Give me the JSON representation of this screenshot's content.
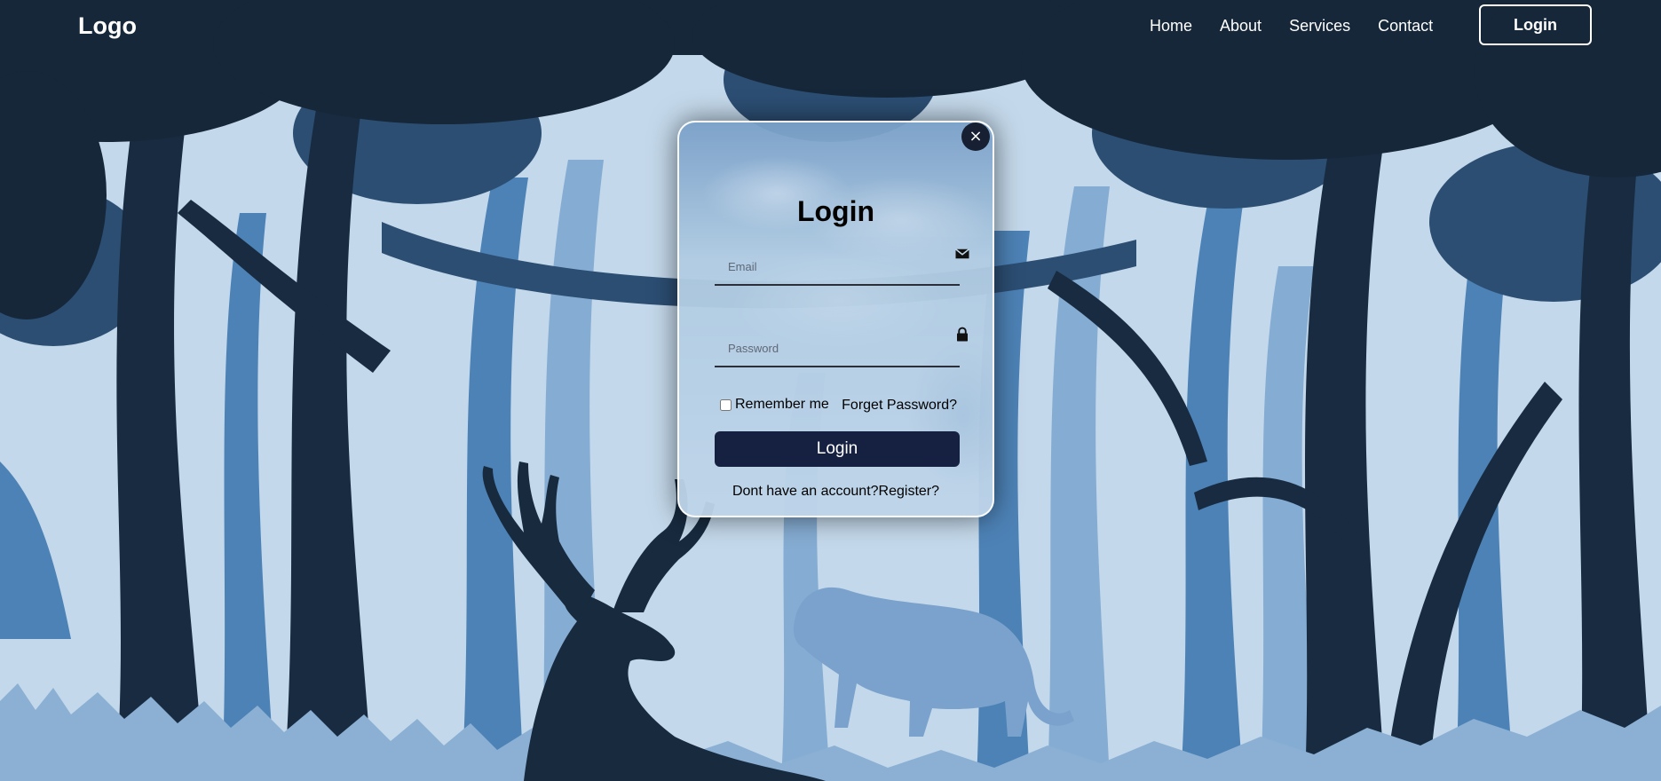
{
  "header": {
    "logo": "Logo",
    "nav": [
      "Home",
      "About",
      "Services",
      "Contact"
    ],
    "login_button": "Login"
  },
  "modal": {
    "close_icon": "×",
    "title": "Login",
    "email": {
      "placeholder": "Email",
      "icon": "envelope-icon"
    },
    "password": {
      "placeholder": "Password",
      "icon": "lock-icon"
    },
    "remember_label": "Remember me",
    "forgot_link": "Forget Password?",
    "submit_label": "Login",
    "register_prompt": "Dont have an account?",
    "register_link": "Register?"
  },
  "colors": {
    "header_bg": "#152636",
    "dark_tree": "#1a2d42",
    "mid_tree": "#2f5a84",
    "light_tree": "#4f84b8",
    "sky": "#c3d8ea",
    "submit_bg": "#162141"
  }
}
